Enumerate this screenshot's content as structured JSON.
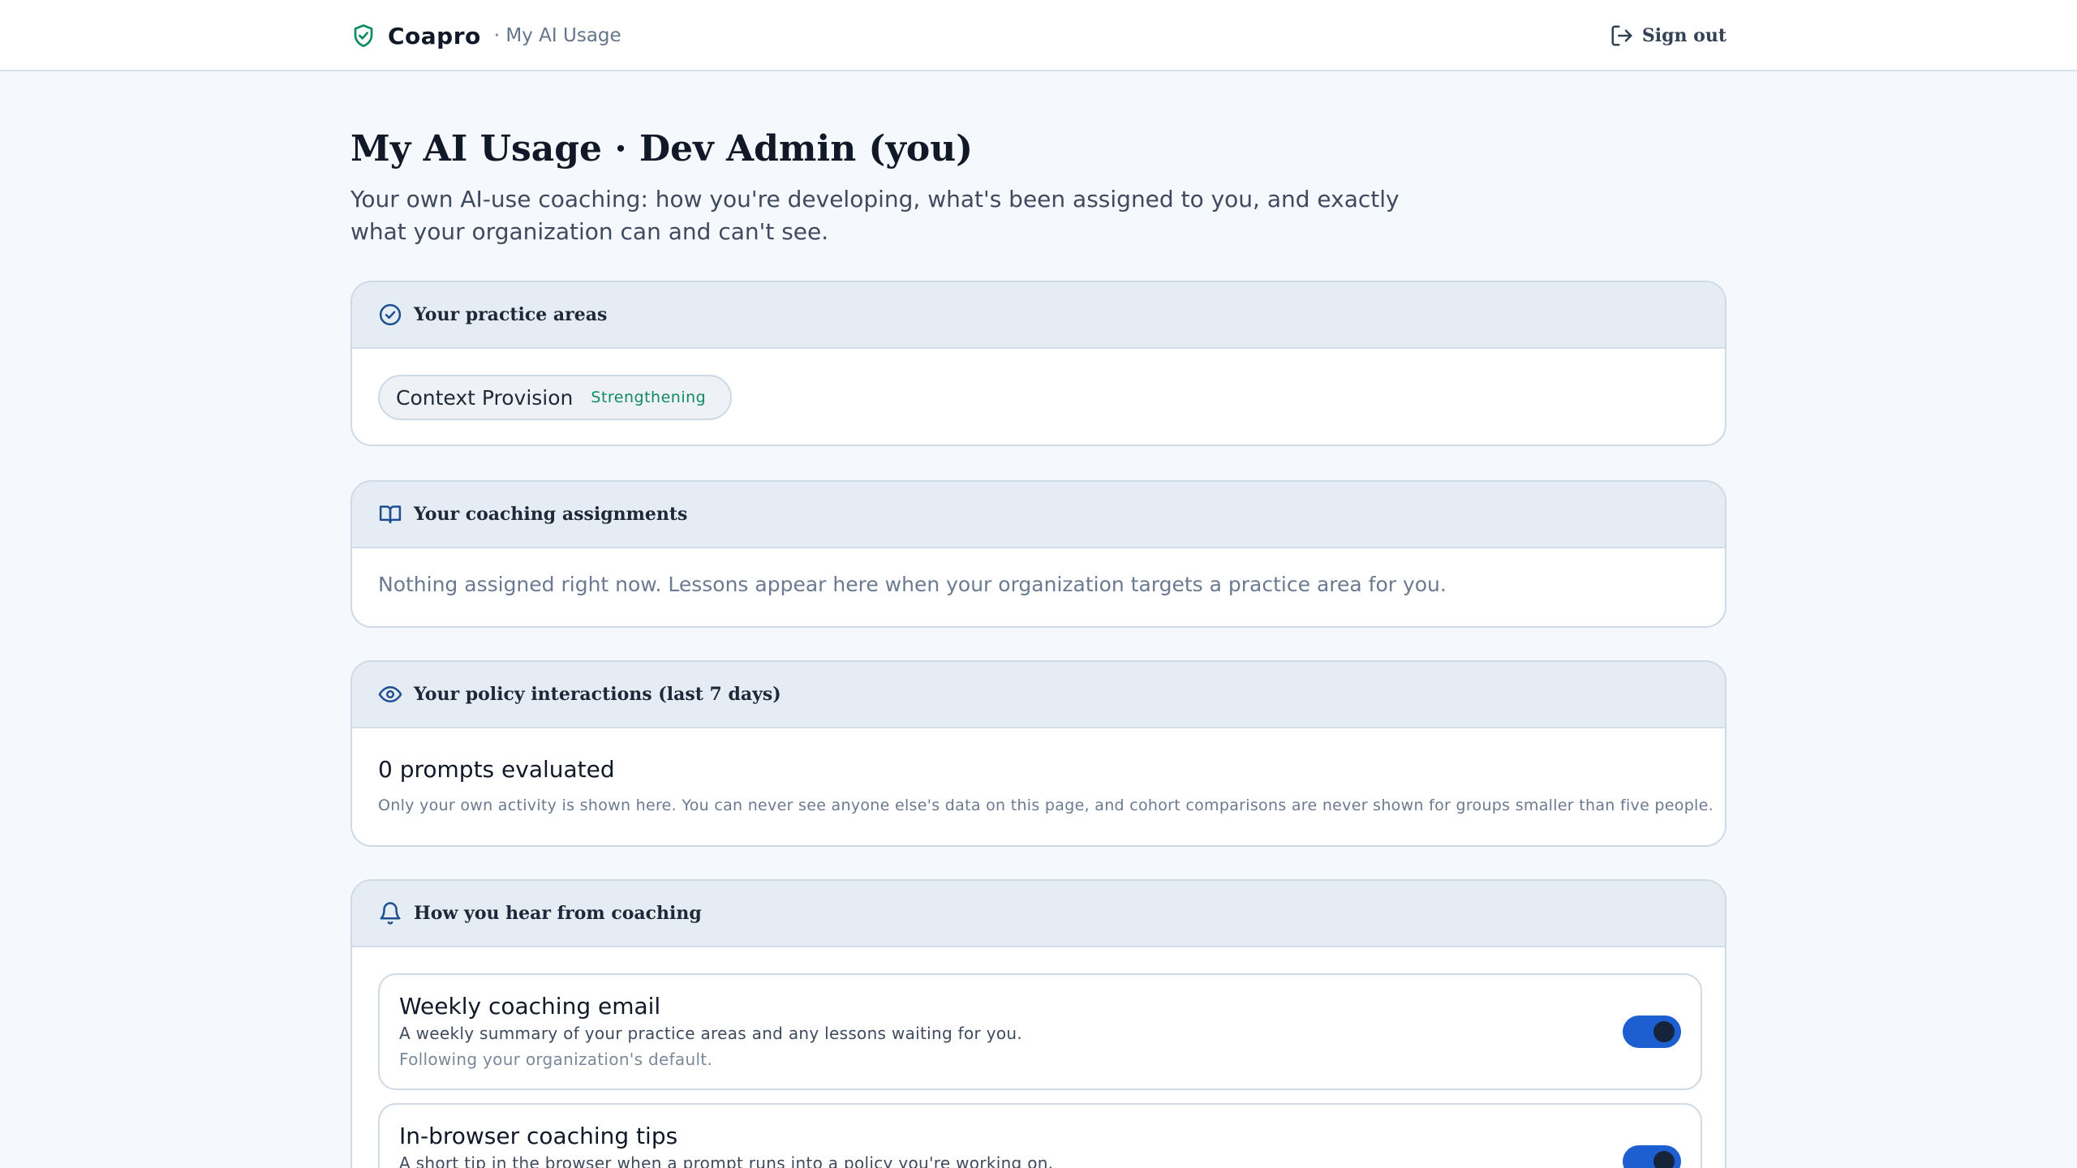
{
  "header": {
    "brand_name": "Coapro",
    "brand_subtitle": "· My AI Usage",
    "sign_out_label": "Sign out"
  },
  "page": {
    "title": "My AI Usage · Dev Admin (you)",
    "description": "Your own AI-use coaching: how you're developing, what's been assigned to you, and exactly what your organization can and can't see."
  },
  "practice_areas": {
    "title": "Your practice areas",
    "items": [
      {
        "label": "Context Provision",
        "status": "Strengthening"
      }
    ]
  },
  "assignments": {
    "title": "Your coaching assignments",
    "empty_text": "Nothing assigned right now. Lessons appear here when your organization targets a practice area for you."
  },
  "policy": {
    "title": "Your policy interactions (last 7 days)",
    "stat": "0 prompts evaluated",
    "privacy_note": "Only your own activity is shown here. You can never see anyone else's data on this page, and cohort comparisons are never shown for groups smaller than five people."
  },
  "coaching_prefs": {
    "title": "How you hear from coaching",
    "items": [
      {
        "title": "Weekly coaching email",
        "description": "A weekly summary of your practice areas and any lessons waiting for you.",
        "status": "Following your organization's default.",
        "enabled": true
      },
      {
        "title": "In-browser coaching tips",
        "description": "A short tip in the browser when a prompt runs into a policy you're working on.",
        "status": "",
        "enabled": true
      }
    ]
  },
  "colors": {
    "accent_green": "#0f8a5f",
    "toggle_on": "#1d5fd1",
    "icon_blue": "#1d4f91",
    "page_bg": "#f5f8fc"
  },
  "icons": {
    "brand": "shield-check-icon",
    "sign_out": "log-out-icon",
    "practice_areas": "check-circle-icon",
    "assignments": "book-open-icon",
    "policy": "eye-icon",
    "coaching_prefs": "bell-icon"
  }
}
